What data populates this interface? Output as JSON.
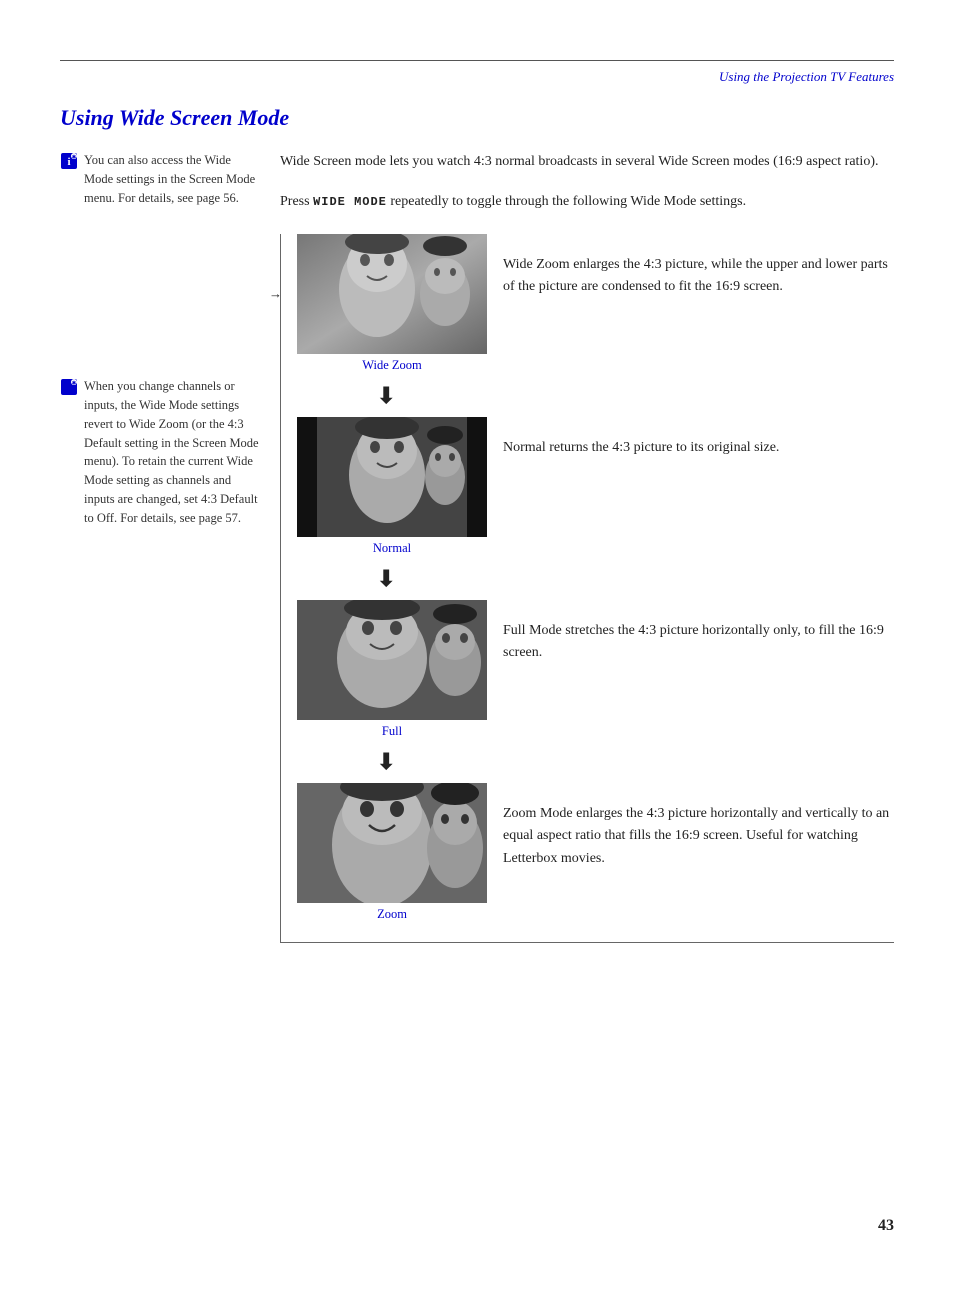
{
  "header": {
    "rule": true,
    "chapter_title": "Using the Projection TV Features"
  },
  "section": {
    "title": "Using Wide Screen Mode"
  },
  "intro": {
    "text": "Wide Screen mode lets you watch 4:3 normal broadcasts in several Wide Screen modes (16:9 aspect ratio)."
  },
  "press_instruction": {
    "prefix": "Press ",
    "keyword": "WIDE MODE",
    "suffix": " repeatedly to toggle through the following Wide Mode settings."
  },
  "notes": [
    {
      "id": "note1",
      "text": "You can also access the Wide Mode settings in the Screen Mode menu. For details, see page 56."
    },
    {
      "id": "note2",
      "text": "When you change channels or inputs, the Wide Mode settings revert to Wide Zoom (or the 4:3 Default setting in the Screen Mode menu). To retain the current Wide Mode setting as channels and inputs are changed, set 4:3 Default to Off. For details, see page 57."
    }
  ],
  "modes": [
    {
      "id": "wide-zoom",
      "label": "Wide Zoom",
      "description": "Wide Zoom enlarges the 4:3 picture, while the upper and lower parts of the picture are condensed to fit the 16:9 screen."
    },
    {
      "id": "normal",
      "label": "Normal",
      "description": "Normal returns the 4:3 picture to its original size."
    },
    {
      "id": "full",
      "label": "Full",
      "description": "Full Mode stretches the 4:3 picture horizontally only, to fill the 16:9 screen."
    },
    {
      "id": "zoom",
      "label": "Zoom",
      "description": "Zoom Mode enlarges the 4:3 picture horizontally and vertically to an equal aspect ratio that fills the 16:9 screen. Useful for watching Letterbox movies."
    }
  ],
  "page_number": "43"
}
